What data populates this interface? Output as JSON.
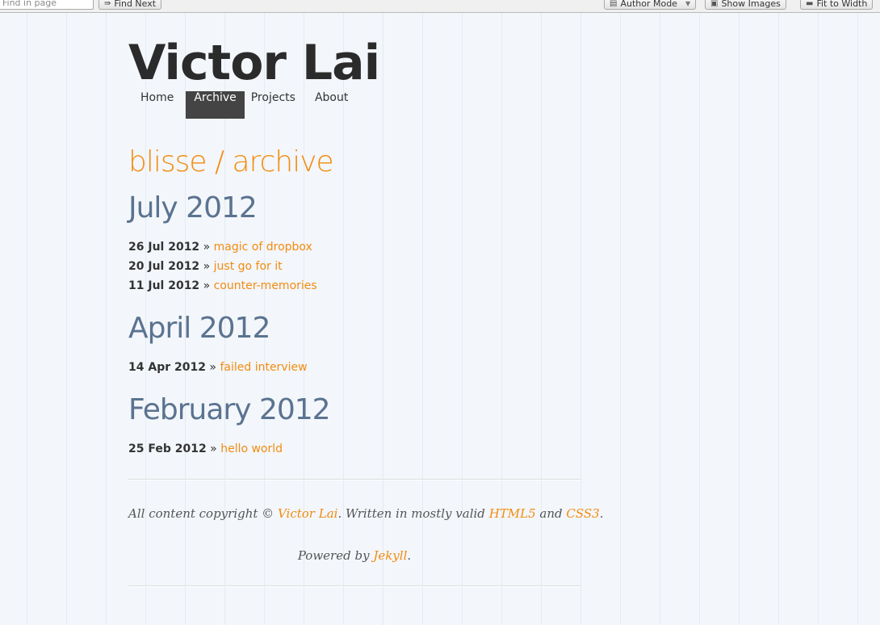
{
  "toolbar": {
    "find_placeholder": "Find in page",
    "find_next": "Find Next",
    "author_mode": "Author Mode",
    "show_images": "Show Images",
    "fit_to_width": "Fit to Width"
  },
  "site": {
    "title": "Victor Lai"
  },
  "nav": {
    "items": [
      {
        "label": "Home"
      },
      {
        "label": "Archive",
        "active": true
      },
      {
        "label": "Projects"
      },
      {
        "label": "About"
      }
    ]
  },
  "page": {
    "breadcrumb": "blisse / archive"
  },
  "archive": [
    {
      "month": "July 2012",
      "posts": [
        {
          "date": "26 Jul 2012",
          "title": "magic of dropbox"
        },
        {
          "date": "20 Jul 2012",
          "title": "just go for it"
        },
        {
          "date": "11 Jul 2012",
          "title": "counter-memories"
        }
      ]
    },
    {
      "month": "April 2012",
      "posts": [
        {
          "date": "14 Apr 2012",
          "title": "failed interview"
        }
      ]
    },
    {
      "month": "February 2012",
      "posts": [
        {
          "date": "25 Feb 2012",
          "title": "hello world"
        }
      ]
    }
  ],
  "post_separator": "»",
  "footer": {
    "copyright_prefix": "All content copyright ©",
    "author": "Victor Lai",
    "written_text": ". Written in mostly valid",
    "html5": "HTML5",
    "and": "and",
    "css3": "CSS3",
    "period": ".",
    "powered_by": "Powered by",
    "jekyll": "Jekyll"
  },
  "colors": {
    "accent": "#f28c0f",
    "month_heading": "#5a7390",
    "nav_active_bg": "#444444",
    "background": "#f3f6fb"
  }
}
